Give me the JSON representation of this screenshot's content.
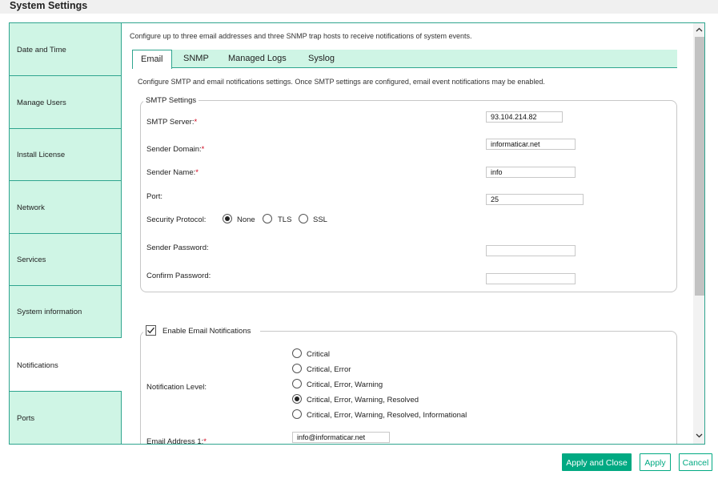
{
  "window": {
    "title": "System Settings"
  },
  "sidebar": {
    "items": [
      {
        "label": "Date and Time"
      },
      {
        "label": "Manage Users"
      },
      {
        "label": "Install License"
      },
      {
        "label": "Network"
      },
      {
        "label": "Services"
      },
      {
        "label": "System information"
      },
      {
        "label": "Notifications",
        "active": true
      },
      {
        "label": "Ports"
      }
    ]
  },
  "main": {
    "intro": "Configure up to three email addresses and three SNMP trap hosts to receive notifications of system events.",
    "tabs": [
      {
        "label": "Email",
        "active": true
      },
      {
        "label": "SNMP"
      },
      {
        "label": "Managed Logs"
      },
      {
        "label": "Syslog"
      }
    ],
    "description": "Configure SMTP and email notifications settings. Once SMTP settings are configured, email event notifications may be enabled.",
    "smtp": {
      "legend": "SMTP Settings",
      "server_label": "SMTP Server:",
      "server_value": "93.104.214.82",
      "domain_label": "Sender Domain:",
      "domain_value": "informaticar.net",
      "name_label": "Sender Name:",
      "name_value": "info",
      "port_label": "Port:",
      "port_value": "25",
      "protocol_label": "Security Protocol:",
      "protocol_options": [
        "None",
        "TLS",
        "SSL"
      ],
      "protocol_selected": "None",
      "password_label": "Sender Password:",
      "password_value": "",
      "confirm_label": "Confirm Password:",
      "confirm_value": "",
      "required_mark": "*"
    },
    "email_notifications": {
      "checkbox_label": "Enable Email Notifications",
      "enabled": true,
      "level_label": "Notification Level:",
      "levels": [
        "Critical",
        "Critical, Error",
        "Critical, Error, Warning",
        "Critical, Error, Warning, Resolved",
        "Critical, Error, Warning, Resolved, Informational"
      ],
      "level_selected": "Critical, Error, Warning, Resolved",
      "address1_label": "Email Address 1:",
      "address1_value": "info@informaticar.net"
    }
  },
  "footer": {
    "apply_close_label": "Apply and Close",
    "apply_label": "Apply",
    "cancel_label": "Cancel"
  },
  "icons": {
    "check": "check-icon",
    "scroll_up": "chevron-up-icon",
    "scroll_down": "chevron-down-icon"
  },
  "colors": {
    "accent": "#01a982",
    "border": "#2fa58f",
    "tab_background": "#cff5e5",
    "required": "#d0021b"
  }
}
